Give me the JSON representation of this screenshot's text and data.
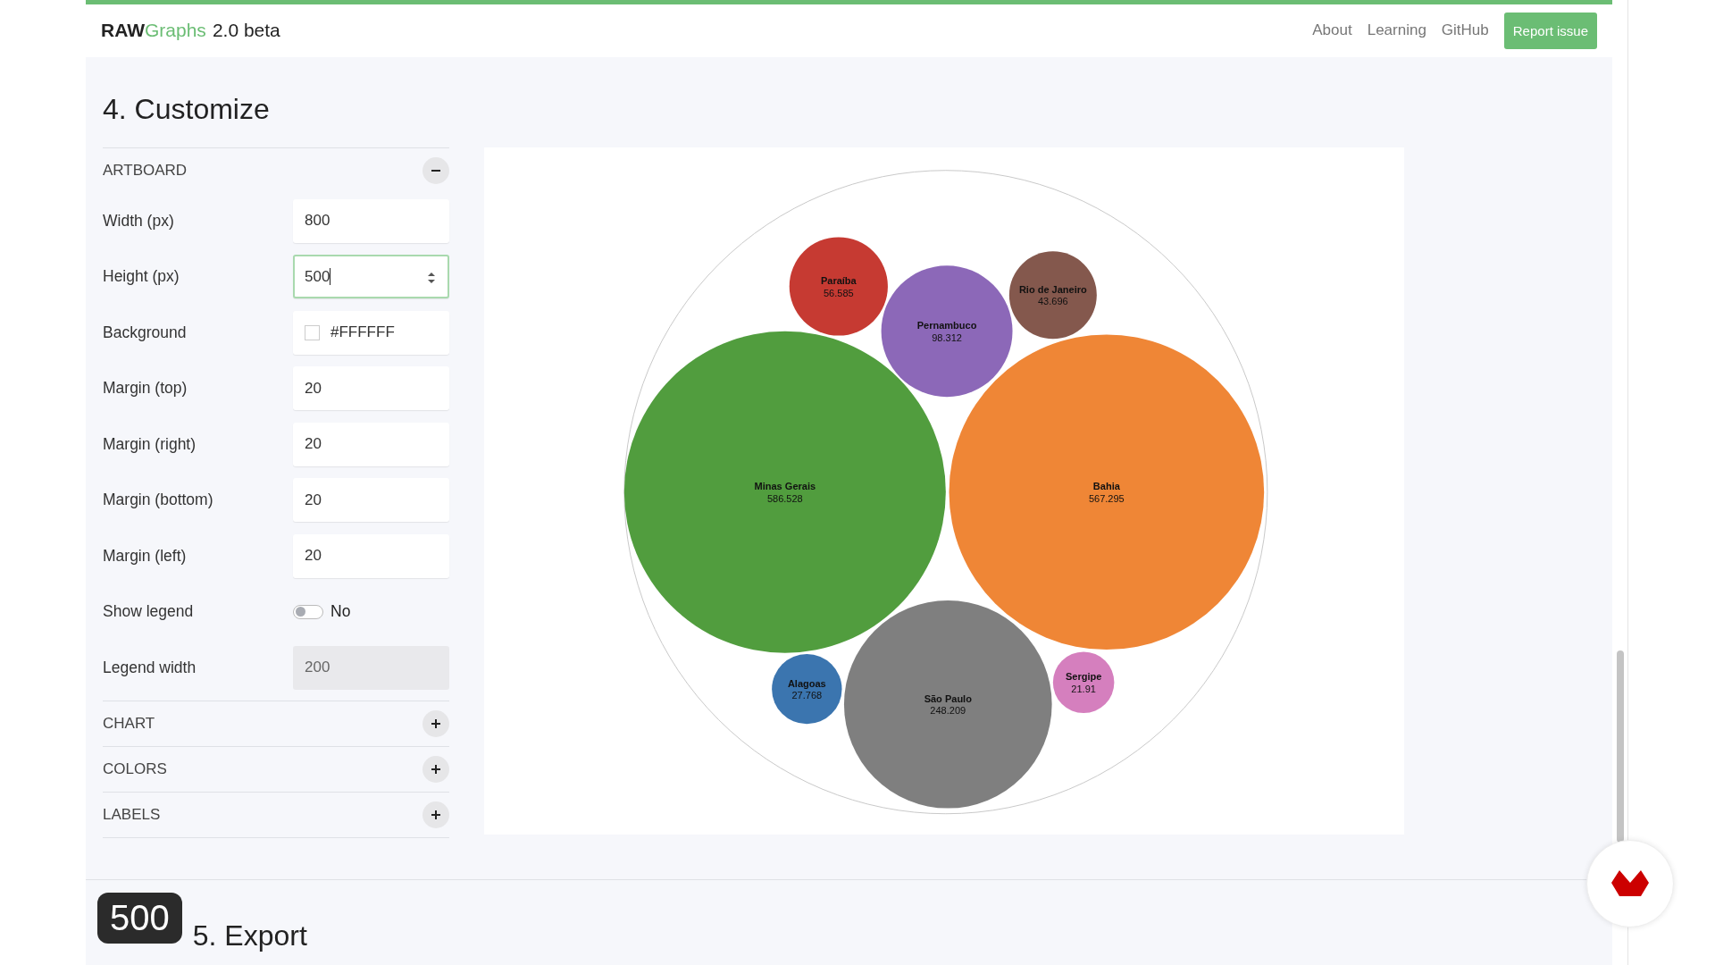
{
  "header": {
    "logo_bold": "RAW",
    "logo_colored": "Graphs",
    "version": "2.0 beta",
    "nav": [
      {
        "label": "About"
      },
      {
        "label": "Learning"
      },
      {
        "label": "GitHub"
      }
    ],
    "report_button": "Report issue"
  },
  "section_title": "4. Customize",
  "groups": [
    {
      "title": "ARTBOARD",
      "expanded": true,
      "fields": [
        {
          "kind": "number",
          "label": "Width (px)",
          "value": "800",
          "focused": false,
          "disabled": false
        },
        {
          "kind": "number",
          "label": "Height (px)",
          "value": "500",
          "focused": true,
          "disabled": false
        },
        {
          "kind": "color",
          "label": "Background",
          "value": "#FFFFFF"
        },
        {
          "kind": "number",
          "label": "Margin (top)",
          "value": "20",
          "focused": false,
          "disabled": false
        },
        {
          "kind": "number",
          "label": "Margin (right)",
          "value": "20",
          "focused": false,
          "disabled": false
        },
        {
          "kind": "number",
          "label": "Margin (bottom)",
          "value": "20",
          "focused": false,
          "disabled": false
        },
        {
          "kind": "number",
          "label": "Margin (left)",
          "value": "20",
          "focused": false,
          "disabled": false
        },
        {
          "kind": "toggle",
          "label": "Show legend",
          "value": "No",
          "on": false
        },
        {
          "kind": "number",
          "label": "Legend width",
          "value": "200",
          "focused": false,
          "disabled": true
        }
      ]
    },
    {
      "title": "CHART",
      "expanded": false
    },
    {
      "title": "COLORS",
      "expanded": false
    },
    {
      "title": "LABELS",
      "expanded": false
    }
  ],
  "bubbles": [
    {
      "name": "Paraíba",
      "value": "56.585",
      "color": "#c63a32"
    },
    {
      "name": "Pernambuco",
      "value": "98.312",
      "color": "#8c68b8"
    },
    {
      "name": "Rio de Janeiro",
      "value": "43.696",
      "color": "#84584d"
    },
    {
      "name": "Minas Gerais",
      "value": "586.528",
      "color": "#519d3e"
    },
    {
      "name": "Bahia",
      "value": "567.295",
      "color": "#ef8636"
    },
    {
      "name": "Alagoas",
      "value": "27.768",
      "color": "#3b75af"
    },
    {
      "name": "São Paulo",
      "value": "248.209",
      "color": "#7f7f7f"
    },
    {
      "name": "Sergipe",
      "value": "21.91",
      "color": "#d57fbe"
    }
  ],
  "next_section_title": "5. Export",
  "keystroke_overlay": "500"
}
